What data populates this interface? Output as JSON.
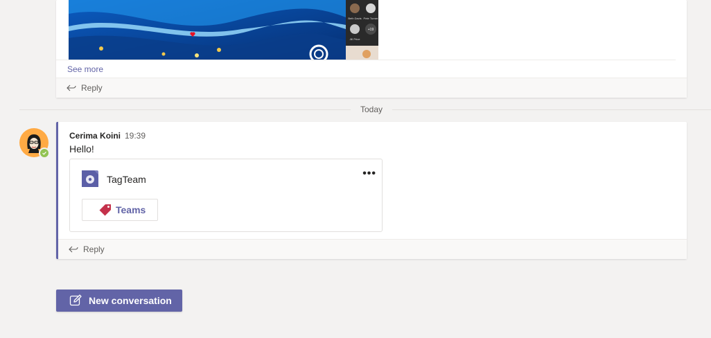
{
  "first_post": {
    "see_more": "See more",
    "reply": "Reply",
    "participants": [
      {
        "name": "Beth Davis"
      },
      {
        "name": "Pete Turner"
      },
      {
        "name": "Jill Price"
      },
      {
        "name": "+19"
      }
    ]
  },
  "divider": {
    "label": "Today"
  },
  "second_post": {
    "author": "Cerima Koini",
    "time": "19:39",
    "message": "Hello!",
    "app_card": {
      "app_name": "TagTeam",
      "more": "•••",
      "tag_label": "Teams"
    },
    "reply": "Reply"
  },
  "compose": {
    "new_conversation": "New conversation"
  },
  "colors": {
    "accent": "#6264a7",
    "presence": "#92c353",
    "avatar_bg": "#ffaa44",
    "tag": "#c4314b"
  }
}
